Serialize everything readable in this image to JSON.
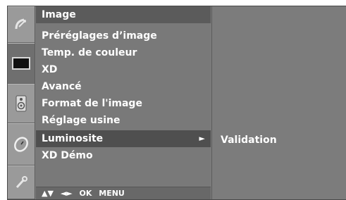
{
  "menu": {
    "title": "Image",
    "items": [
      {
        "label": "Préréglages d’image"
      },
      {
        "label": "Temp. de couleur"
      },
      {
        "label": "XD"
      },
      {
        "label": "Avancé"
      },
      {
        "label": "Format de l'image"
      },
      {
        "label": "Réglage usine"
      },
      {
        "label": "Luminosite",
        "selected": true
      },
      {
        "label": "XD Démo"
      }
    ],
    "footer": {
      "nav_arrows_vertical": "▲▼",
      "nav_arrows_horizontal": "◄►",
      "ok_label": "OK",
      "menu_label": "MENU"
    }
  },
  "submenu": {
    "value": "Validation"
  },
  "icons": [
    {
      "name": "satellite-dish-icon"
    },
    {
      "name": "picture-icon",
      "selected": true
    },
    {
      "name": "speaker-icon"
    },
    {
      "name": "clock-icon"
    },
    {
      "name": "wrench-icon"
    }
  ],
  "colors": {
    "panel": "#7e7e7e",
    "header": "#5b5b5b",
    "highlight": "#4f4f4f",
    "text": "#ffffff"
  }
}
